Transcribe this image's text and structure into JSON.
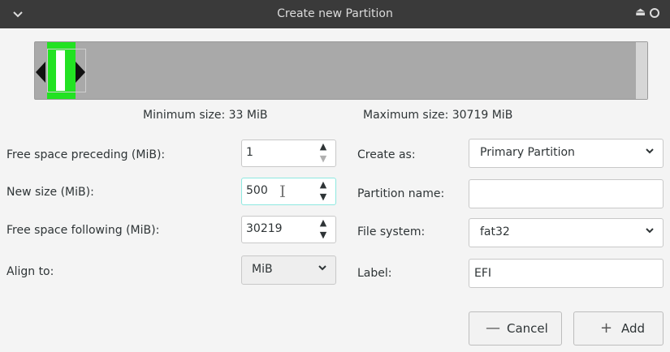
{
  "window": {
    "title": "Create new Partition",
    "menu_icon": "chevron-down-icon",
    "eject_icon": "eject-icon",
    "close_icon": "circle-icon"
  },
  "sizes": {
    "minimum": "Minimum size: 33 MiB",
    "maximum": "Maximum size: 30719 MiB"
  },
  "left": {
    "preceding_label": "Free space preceding (MiB):",
    "preceding_value": "1",
    "new_size_label": "New size (MiB):",
    "new_size_value": "500",
    "following_label": "Free space following (MiB):",
    "following_value": "30219",
    "align_label": "Align to:",
    "align_value": "MiB"
  },
  "right": {
    "create_as_label": "Create as:",
    "create_as_value": "Primary Partition",
    "partition_name_label": "Partition name:",
    "partition_name_value": "",
    "file_system_label": "File system:",
    "file_system_value": "fat32",
    "label_label": "Label:",
    "label_value": "EFI"
  },
  "buttons": {
    "cancel": "Cancel",
    "add": "Add"
  },
  "colors": {
    "partition_fill": "#22e222",
    "unallocated": "#a9a9a9",
    "titlebar": "#3a3a3a"
  }
}
